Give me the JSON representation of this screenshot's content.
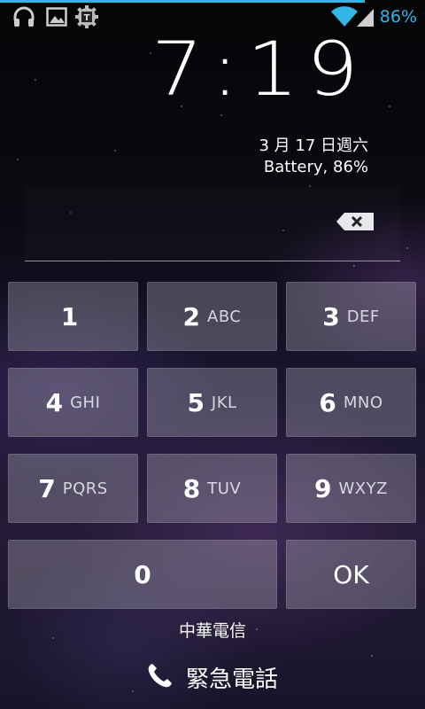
{
  "status_bar": {
    "left_icons": [
      "headphones-icon",
      "gallery-icon",
      "gear-badge-icon"
    ],
    "right_icons": [
      "wifi-icon",
      "signal-icon"
    ],
    "battery_percent": "86%",
    "accent_color": "#33b5e5"
  },
  "lockscreen": {
    "time": "7:19",
    "date": "3 月 17 日週六",
    "battery": "Battery, 86%"
  },
  "keypad": {
    "keys": [
      {
        "number": "1",
        "letters": ""
      },
      {
        "number": "2",
        "letters": "ABC"
      },
      {
        "number": "3",
        "letters": "DEF"
      },
      {
        "number": "4",
        "letters": "GHI"
      },
      {
        "number": "5",
        "letters": "JKL"
      },
      {
        "number": "6",
        "letters": "MNO"
      },
      {
        "number": "7",
        "letters": "PQRS"
      },
      {
        "number": "8",
        "letters": "TUV"
      },
      {
        "number": "9",
        "letters": "WXYZ"
      },
      {
        "number": "0",
        "letters": ""
      }
    ],
    "ok_label": "OK"
  },
  "carrier": "中華電信",
  "emergency": {
    "label": "緊急電話",
    "icon": "phone-icon"
  }
}
